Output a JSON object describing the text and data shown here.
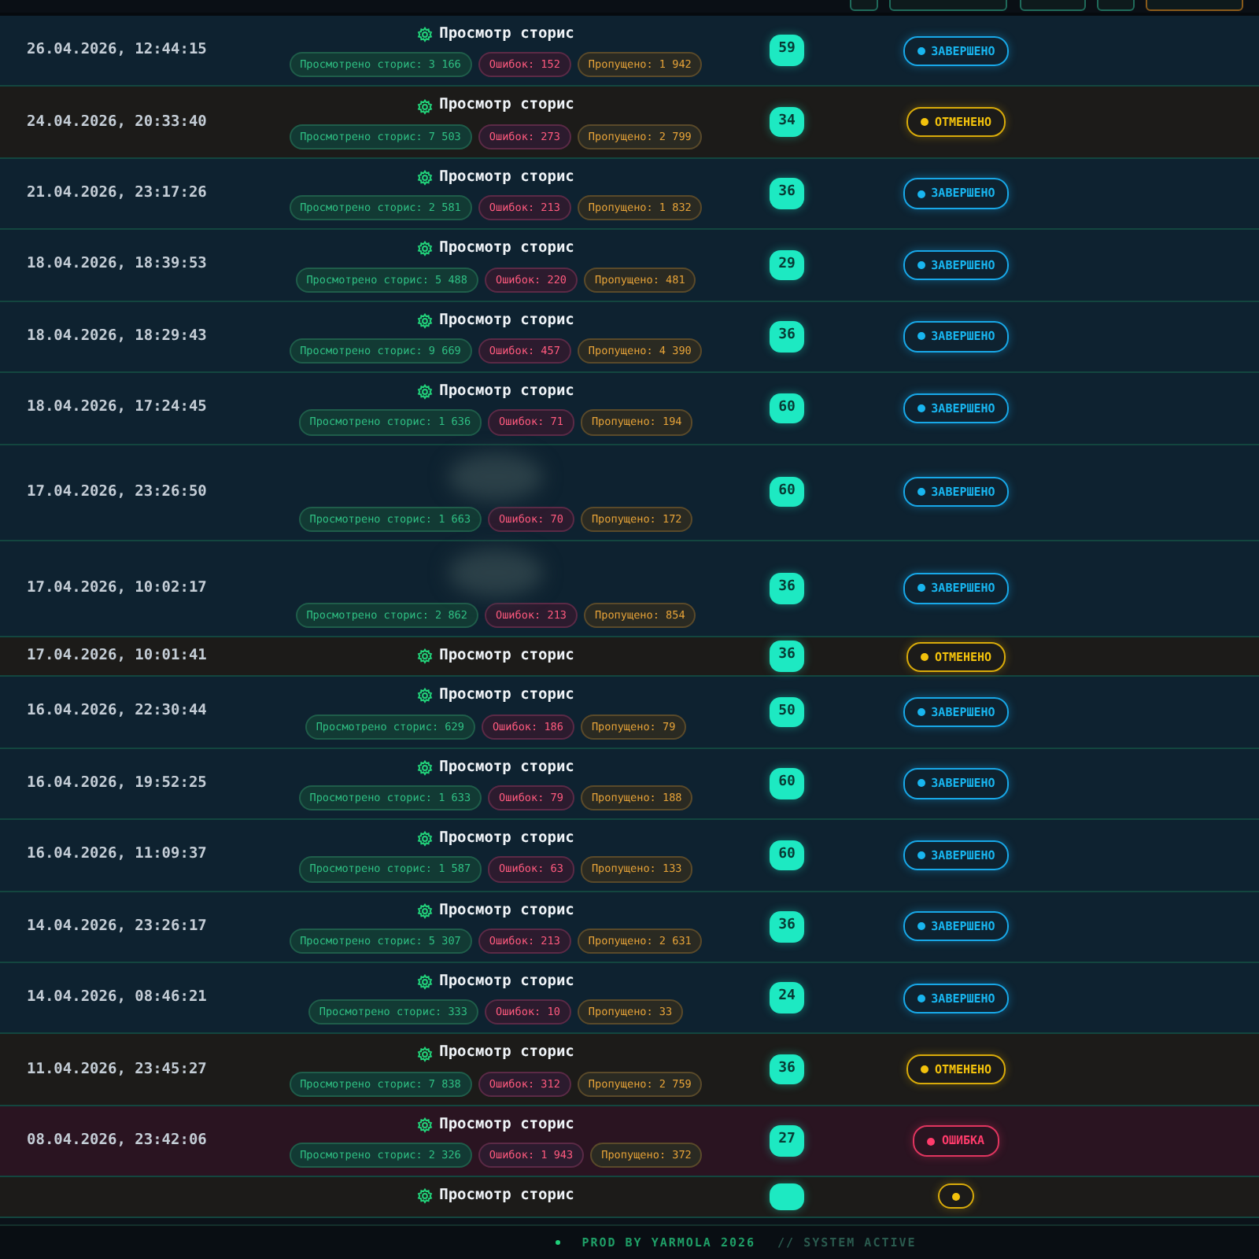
{
  "rows": [
    {
      "time": "26.04.2026, 12:44:15",
      "title": "Просмотр сторис",
      "stats": {
        "viewed": "Просмотрено сторис: 3 166",
        "errors": "Ошибок: 152",
        "skipped": "Пропущено: 1 942"
      },
      "count": "59",
      "status": {
        "kind": "done",
        "label": "ЗАВЕРШЕНО"
      }
    },
    {
      "time": "24.04.2026, 20:33:40",
      "title": "Просмотр сторис",
      "stats": {
        "viewed": "Просмотрено сторис: 7 503",
        "errors": "Ошибок: 273",
        "skipped": "Пропущено: 2 799"
      },
      "count": "34",
      "status": {
        "kind": "cancelled",
        "label": "ОТМЕНЕНО"
      }
    },
    {
      "time": "21.04.2026, 23:17:26",
      "title": "Просмотр сторис",
      "stats": {
        "viewed": "Просмотрено сторис: 2 581",
        "errors": "Ошибок: 213",
        "skipped": "Пропущено: 1 832"
      },
      "count": "36",
      "status": {
        "kind": "done",
        "label": "ЗАВЕРШЕНО"
      }
    },
    {
      "time": "18.04.2026, 18:39:53",
      "title": "Просмотр сторис",
      "stats": {
        "viewed": "Просмотрено сторис: 5 488",
        "errors": "Ошибок: 220",
        "skipped": "Пропущено: 481"
      },
      "count": "29",
      "status": {
        "kind": "done",
        "label": "ЗАВЕРШЕНО"
      }
    },
    {
      "time": "18.04.2026, 18:29:43",
      "title": "Просмотр сторис",
      "stats": {
        "viewed": "Просмотрено сторис: 9 669",
        "errors": "Ошибок: 457",
        "skipped": "Пропущено: 4 390"
      },
      "count": "36",
      "status": {
        "kind": "done",
        "label": "ЗАВЕРШЕНО"
      }
    },
    {
      "time": "18.04.2026, 17:24:45",
      "title": "Просмотр сторис",
      "stats": {
        "viewed": "Просмотрено сторис: 1 636",
        "errors": "Ошибок: 71",
        "skipped": "Пропущено: 194"
      },
      "count": "60",
      "status": {
        "kind": "done",
        "label": "ЗАВЕРШЕНО"
      }
    },
    {
      "time": "17.04.2026, 23:26:50",
      "blurred": true,
      "stats": {
        "viewed": "Просмотрено сторис: 1 663",
        "errors": "Ошибок: 70",
        "skipped": "Пропущено: 172"
      },
      "count": "60",
      "status": {
        "kind": "done",
        "label": "ЗАВЕРШЕНО"
      }
    },
    {
      "time": "17.04.2026, 10:02:17",
      "blurred": true,
      "stats": {
        "viewed": "Просмотрено сторис: 2 862",
        "errors": "Ошибок: 213",
        "skipped": "Пропущено: 854"
      },
      "count": "36",
      "status": {
        "kind": "done",
        "label": "ЗАВЕРШЕНО"
      }
    },
    {
      "time": "17.04.2026, 10:01:41",
      "title": "Просмотр сторис",
      "count": "36",
      "status": {
        "kind": "cancelled",
        "label": "ОТМЕНЕНО"
      }
    },
    {
      "time": "16.04.2026, 22:30:44",
      "title": "Просмотр сторис",
      "stats": {
        "viewed": "Просмотрено сторис: 629",
        "errors": "Ошибок: 186",
        "skipped": "Пропущено: 79"
      },
      "count": "50",
      "status": {
        "kind": "done",
        "label": "ЗАВЕРШЕНО"
      }
    },
    {
      "time": "16.04.2026, 19:52:25",
      "title": "Просмотр сторис",
      "stats": {
        "viewed": "Просмотрено сторис: 1 633",
        "errors": "Ошибок: 79",
        "skipped": "Пропущено: 188"
      },
      "count": "60",
      "status": {
        "kind": "done",
        "label": "ЗАВЕРШЕНО"
      }
    },
    {
      "time": "16.04.2026, 11:09:37",
      "title": "Просмотр сторис",
      "stats": {
        "viewed": "Просмотрено сторис: 1 587",
        "errors": "Ошибок: 63",
        "skipped": "Пропущено: 133"
      },
      "count": "60",
      "status": {
        "kind": "done",
        "label": "ЗАВЕРШЕНО"
      }
    },
    {
      "time": "14.04.2026, 23:26:17",
      "title": "Просмотр сторис",
      "stats": {
        "viewed": "Просмотрено сторис: 5 307",
        "errors": "Ошибок: 213",
        "skipped": "Пропущено: 2 631"
      },
      "count": "36",
      "status": {
        "kind": "done",
        "label": "ЗАВЕРШЕНО"
      }
    },
    {
      "time": "14.04.2026, 08:46:21",
      "title": "Просмотр сторис",
      "stats": {
        "viewed": "Просмотрено сторис: 333",
        "errors": "Ошибок: 10",
        "skipped": "Пропущено: 33"
      },
      "count": "24",
      "status": {
        "kind": "done",
        "label": "ЗАВЕРШЕНО"
      }
    },
    {
      "time": "11.04.2026, 23:45:27",
      "title": "Просмотр сторис",
      "stats": {
        "viewed": "Просмотрено сторис: 7 838",
        "errors": "Ошибок: 312",
        "skipped": "Пропущено: 2 759"
      },
      "count": "36",
      "status": {
        "kind": "cancelled",
        "label": "ОТМЕНЕНО"
      }
    },
    {
      "time": "08.04.2026, 23:42:06",
      "title": "Просмотр сторис",
      "stats": {
        "viewed": "Просмотрено сторис: 2 326",
        "errors": "Ошибок: 1 943",
        "skipped": "Пропущено: 372"
      },
      "count": "27",
      "status": {
        "kind": "error",
        "label": "ОШИБКА"
      }
    },
    {
      "title": "Просмотр сторис",
      "status": {
        "kind": "cancelled"
      }
    }
  ],
  "footer": {
    "credit": "PROD BY YARMOLA 2026",
    "state": "// SYSTEM ACTIVE"
  }
}
